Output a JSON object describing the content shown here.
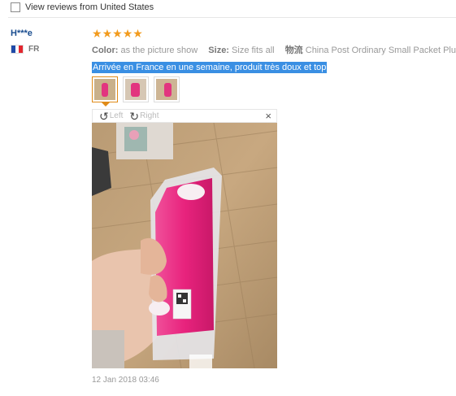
{
  "filter": {
    "label": "View reviews from United States"
  },
  "user": {
    "name": "H***e",
    "country_code": "FR"
  },
  "review": {
    "stars": 5,
    "star_glyph": "★",
    "color_label": "Color:",
    "color_value": "as the picture show",
    "size_label": "Size:",
    "size_value": "Size fits all",
    "shipping_label": "物流",
    "shipping_value": "China Post Ordinary Small Packet Plus",
    "text": "Arrivée en France en une semaine, produit très doux et top",
    "date": "12 Jan 2018 03:46"
  },
  "thumbnails": [
    {
      "name": "photo-1",
      "active": true
    },
    {
      "name": "photo-2",
      "active": false
    },
    {
      "name": "photo-3",
      "active": false
    }
  ],
  "viewer": {
    "rotate_left_label": "Left",
    "rotate_right_label": "Right",
    "close_glyph": "×"
  },
  "colors": {
    "accent": "#e08b18",
    "star": "#f29b1d",
    "highlight": "#3a8fe3",
    "username": "#1a4d8f"
  }
}
